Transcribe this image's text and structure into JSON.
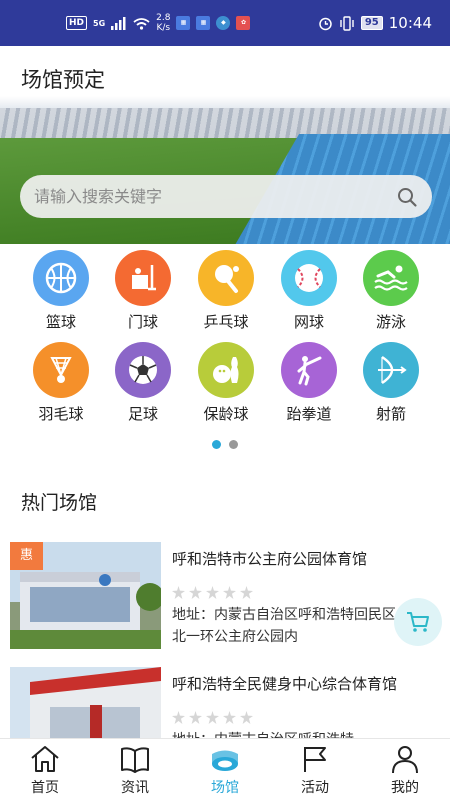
{
  "status_bar": {
    "network_badge": "HD",
    "network_type": "5G",
    "speed_value": "2.8",
    "speed_unit": "K/s",
    "battery": "95",
    "time": "10:44"
  },
  "header": {
    "title": "场馆预定"
  },
  "search": {
    "placeholder": "请输入搜索关键字",
    "value": ""
  },
  "categories": [
    {
      "label": "篮球",
      "icon": "basketball-icon",
      "color": "#5aa6f0"
    },
    {
      "label": "门球",
      "icon": "gateball-icon",
      "color": "#f46a32"
    },
    {
      "label": "乒乓球",
      "icon": "ping-pong-icon",
      "color": "#f7b529"
    },
    {
      "label": "网球",
      "icon": "tennis-ball-icon",
      "color": "#52c8ec"
    },
    {
      "label": "游泳",
      "icon": "swimming-icon",
      "color": "#5ccb4c"
    },
    {
      "label": "羽毛球",
      "icon": "badminton-icon",
      "color": "#f5902a"
    },
    {
      "label": "足球",
      "icon": "soccer-ball-icon",
      "color": "#8b66c8"
    },
    {
      "label": "保龄球",
      "icon": "bowling-icon",
      "color": "#b8cc3a"
    },
    {
      "label": "跆拳道",
      "icon": "taekwondo-icon",
      "color": "#a764d6"
    },
    {
      "label": "射箭",
      "icon": "archery-icon",
      "color": "#3fb3d4"
    }
  ],
  "pager": {
    "pages": 2,
    "active": 1
  },
  "hot_venues": {
    "title": "热门场馆",
    "items": [
      {
        "badge": "惠",
        "name": "呼和浩特市公主府公园体育馆",
        "rating": 0,
        "address": "地址：内蒙古自治区呼和浩特回民区北一环公主府公园内"
      },
      {
        "badge": "",
        "name": "呼和浩特全民健身中心综合体育馆",
        "rating": 0,
        "address": "地址：内蒙古自治区呼和浩特"
      }
    ]
  },
  "tabbar": {
    "items": [
      {
        "label": "首页",
        "icon": "home-icon"
      },
      {
        "label": "资讯",
        "icon": "book-icon"
      },
      {
        "label": "场馆",
        "icon": "stadium-icon"
      },
      {
        "label": "活动",
        "icon": "flag-icon"
      },
      {
        "label": "我的",
        "icon": "person-icon"
      }
    ],
    "active": 2
  },
  "colors": {
    "status_bar": "#2f3a9a",
    "accent": "#2aa8d8",
    "badge": "#f27a3e",
    "cart_bg": "#dff4f7"
  }
}
